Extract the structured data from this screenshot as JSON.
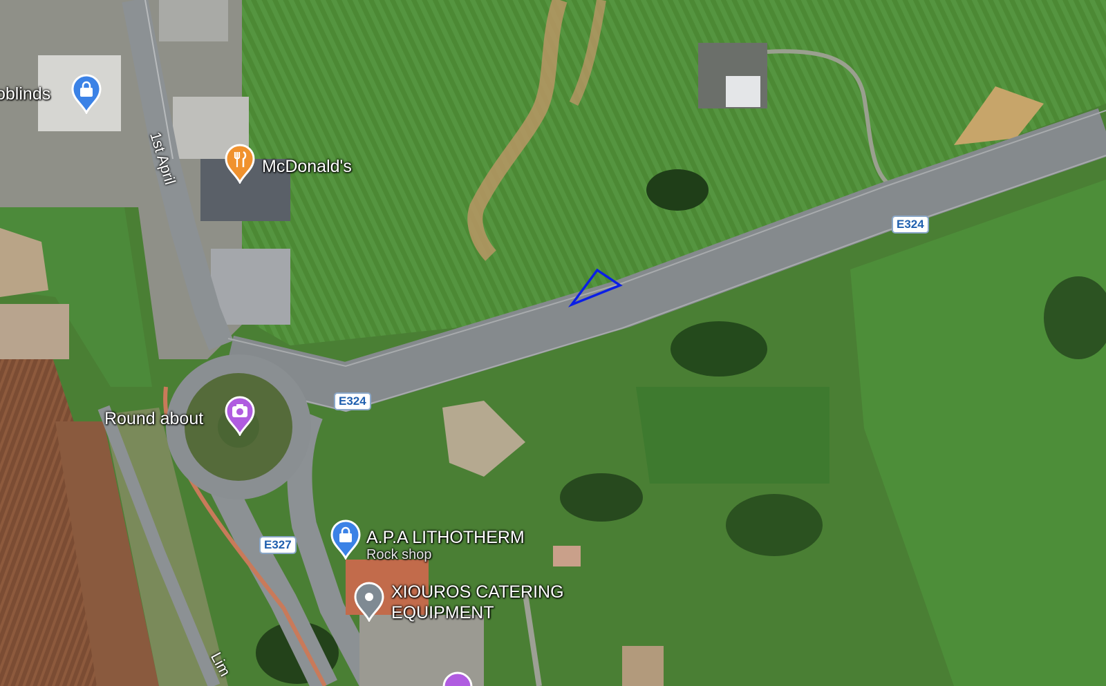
{
  "map": {
    "type": "satellite",
    "colors": {
      "field": "#4f8a36",
      "field_dark": "#2f5a23",
      "road": "#8a8f92",
      "road_edge": "#b9bcbe",
      "soil": "#c9a36b",
      "plowed": "#7a4a32",
      "shield_text": "#1f5fae",
      "selection": "#0a1ee6",
      "pin_blue": "#3b82e6",
      "pin_orange": "#f0922e",
      "pin_purple": "#b05ce0",
      "pin_gray": "#7f8a93"
    }
  },
  "places": {
    "blinds": {
      "label": "oblinds",
      "icon": "shopping-bag-icon"
    },
    "mcdonalds": {
      "label": "McDonald's",
      "icon": "restaurant-icon"
    },
    "roundabout": {
      "label": "Round about",
      "icon": "camera-icon"
    },
    "lithotherm": {
      "label": "A.P.A LITHOTHERM",
      "sublabel": "Rock shop",
      "icon": "shopping-bag-icon"
    },
    "xiouros": {
      "label_line1": "XIOUROS CATERING",
      "label_line2": "EQUIPMENT",
      "icon": "location-dot-icon"
    }
  },
  "roads": {
    "first_april": "1st April",
    "lim": "Lim",
    "e324_a": "E324",
    "e324_b": "E324",
    "e327": "E327"
  }
}
